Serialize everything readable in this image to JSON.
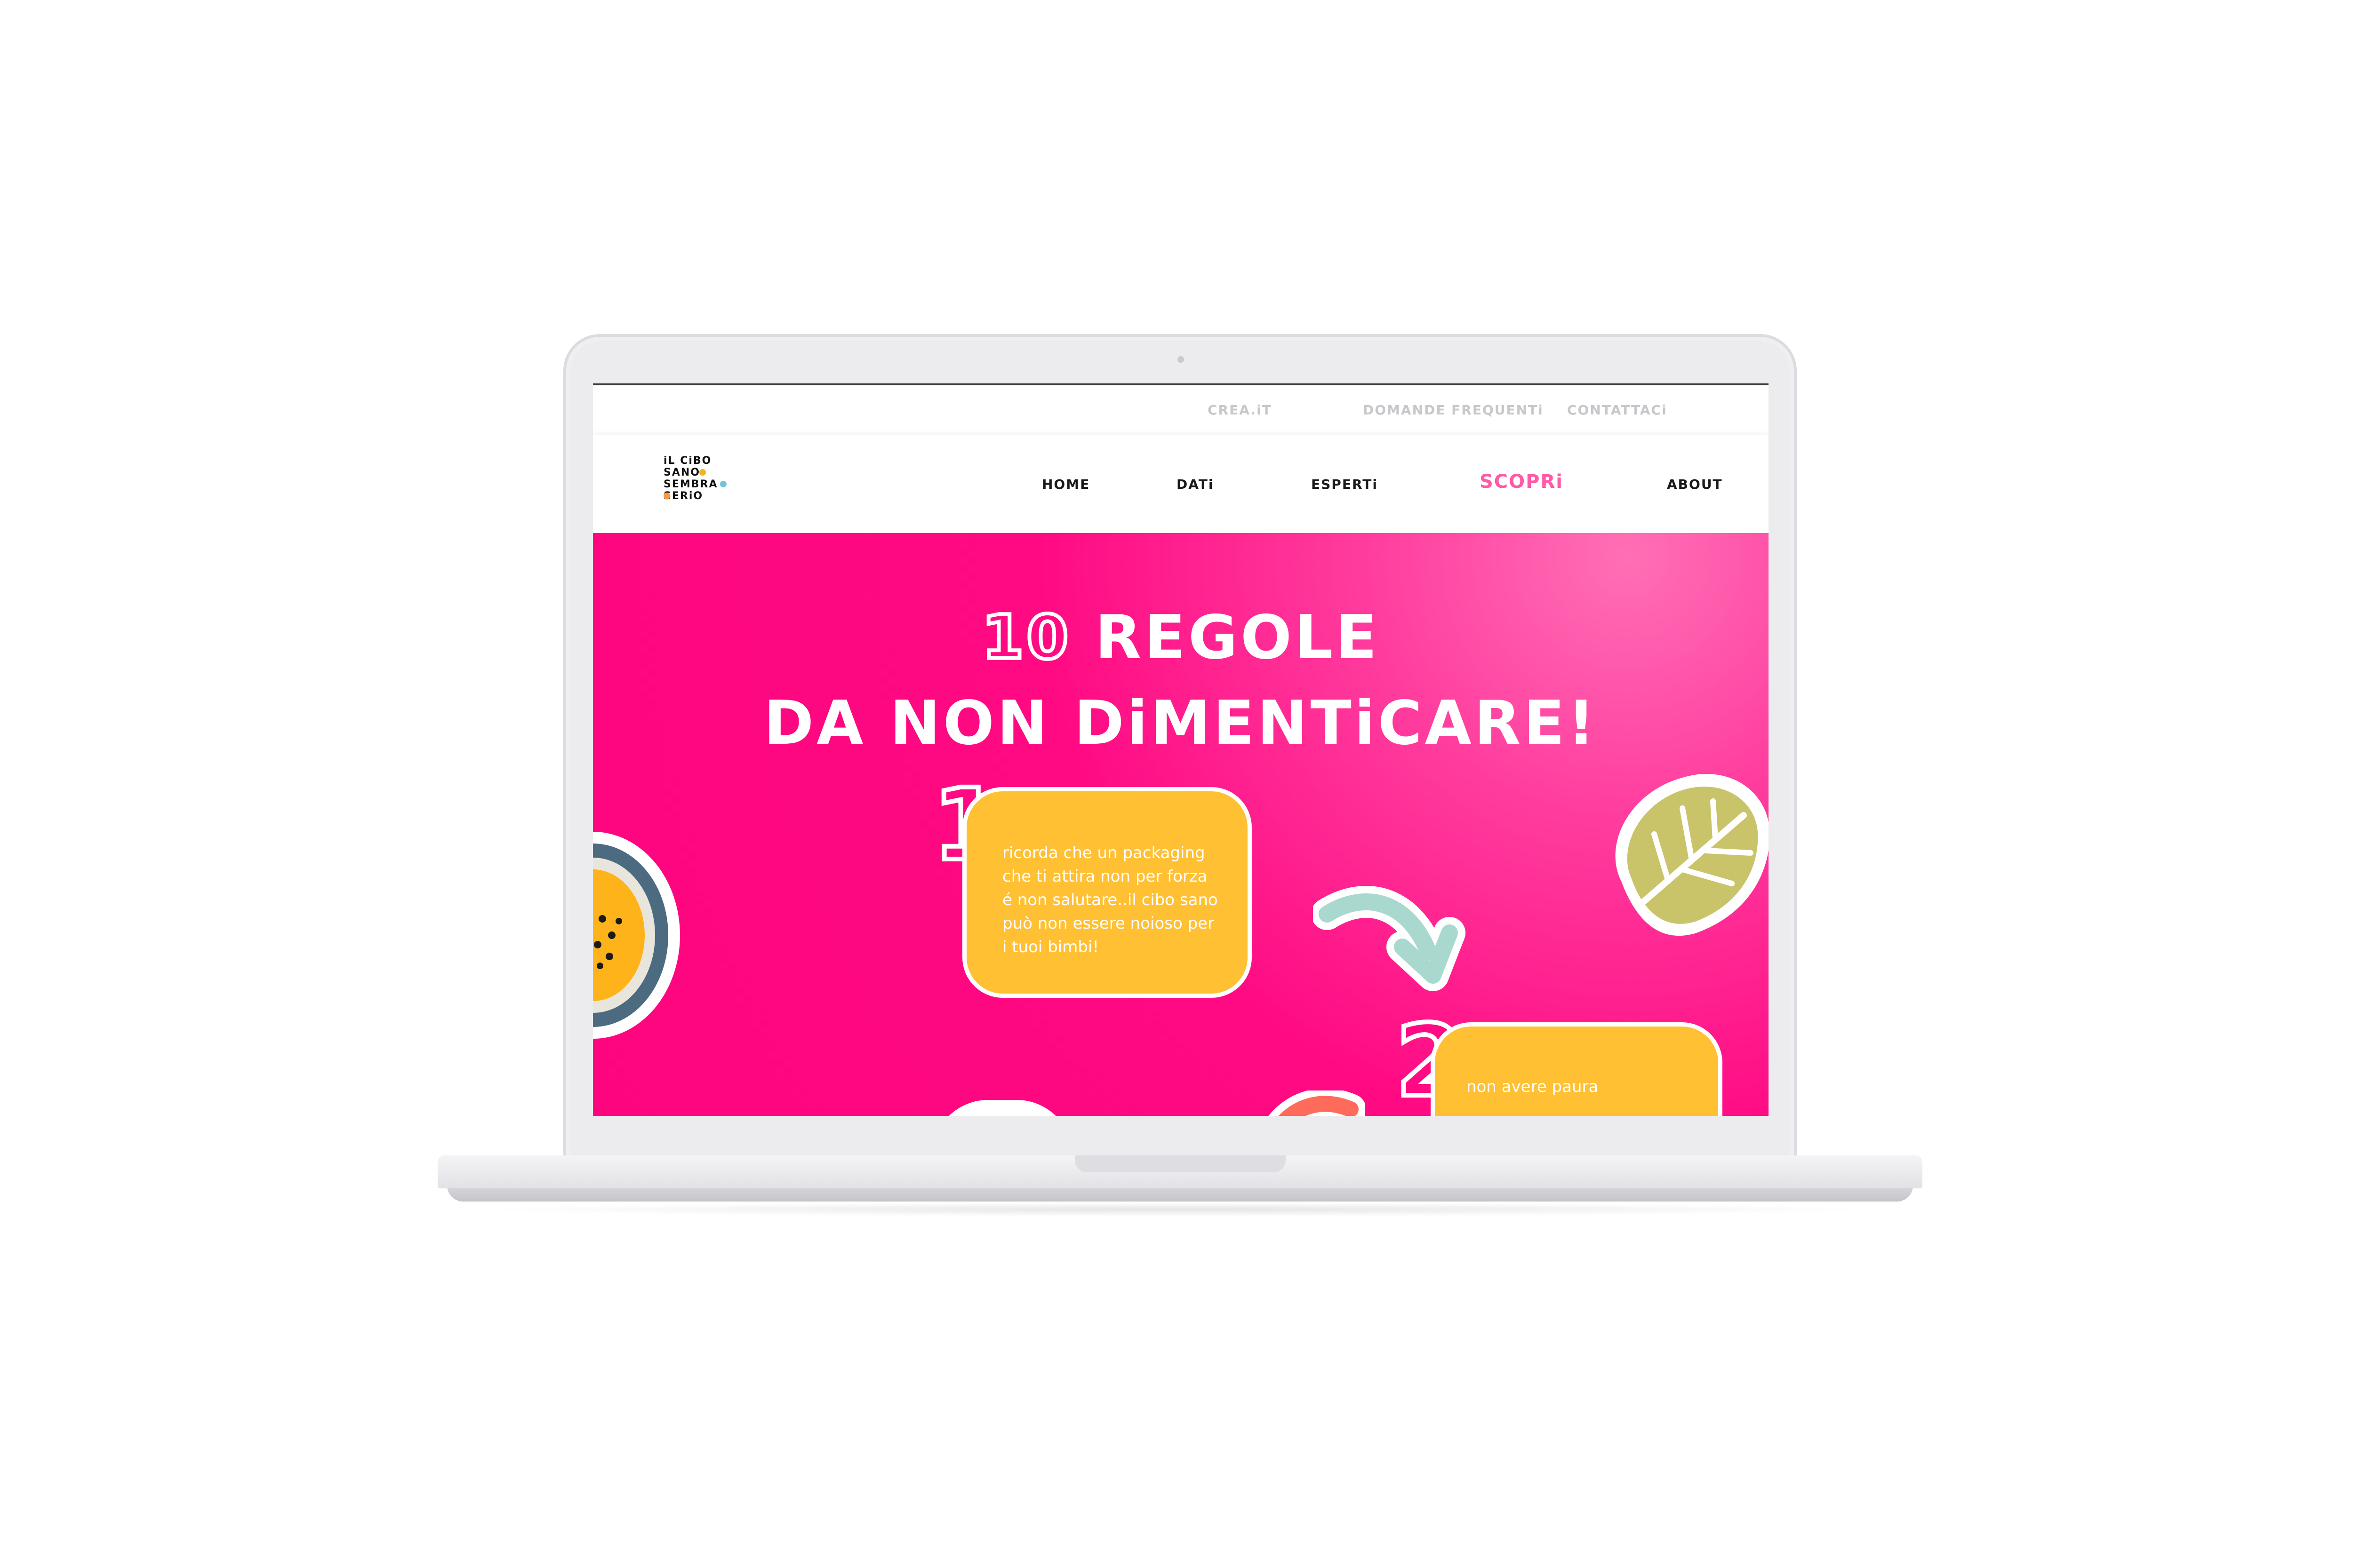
{
  "utility_nav": {
    "links": [
      "CREA.iT",
      "DOMANDE FREQUENTi",
      "CONTATTACi"
    ]
  },
  "logo": {
    "lines": [
      "iL CiBO",
      "SANO",
      "SEMBRA",
      "SERiO"
    ]
  },
  "main_nav": {
    "home": "HOME",
    "dati": "DATi",
    "esperti": "ESPERTi",
    "scopri": "SCOPRi",
    "about": "ABOUT",
    "active": "SCOPRi"
  },
  "hero": {
    "title_number": "10",
    "title_line1_rest": " REGOLE",
    "title_line2": "DA NON DiMENTiCARE!"
  },
  "rules": [
    {
      "number": "1",
      "text_lines": [
        "ricorda che un packaging",
        "che ti attira non per forza",
        "é non salutare..il cibo sano",
        "può non essere noioso per",
        "i tuoi bimbi!"
      ]
    },
    {
      "number": "2",
      "text_lines": [
        "non avere paura"
      ]
    }
  ],
  "colors": {
    "hero_pink": "#ff0a83",
    "accent_pink": "#ff59a8",
    "card_yellow": "#ffc033",
    "leaf_green": "#c9c46a",
    "arrow_mint": "#a9d8cf",
    "arrow_coral": "#ff6b5a"
  },
  "icons": [
    "passion-fruit-icon",
    "monstera-leaf-icon",
    "arrow-right-icon",
    "arrow-left-icon"
  ]
}
